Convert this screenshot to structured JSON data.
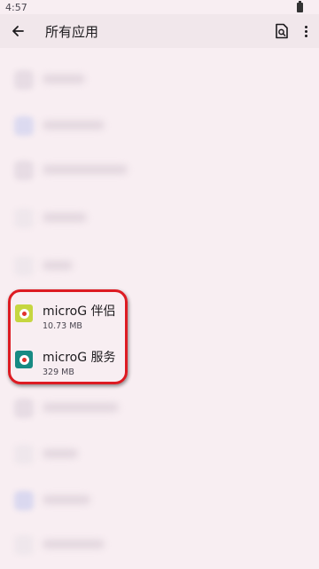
{
  "status_bar": {
    "time": "4:57"
  },
  "app_bar": {
    "title": "所有应用"
  },
  "apps": [
    {
      "name": "microG 伴侣",
      "size": "10.73 MB",
      "icon_color": "#c6d640"
    },
    {
      "name": "microG 服务",
      "size": "329 MB",
      "icon_color": "#178a83"
    }
  ],
  "colors": {
    "background": "#f8eef2",
    "highlight": "#dd1b22"
  }
}
